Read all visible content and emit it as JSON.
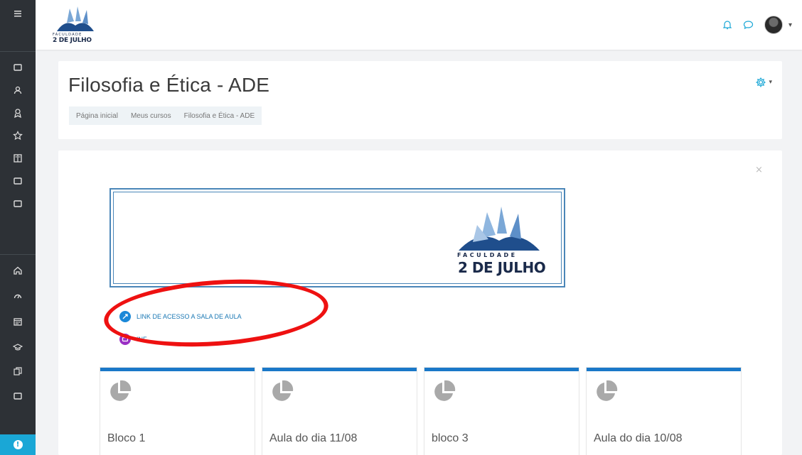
{
  "sidebar": {
    "items": [
      {
        "icon": "menu-icon",
        "label": "Menu"
      },
      {
        "icon": "folder-icon",
        "label": "Folder"
      },
      {
        "icon": "users-icon",
        "label": "Participants"
      },
      {
        "icon": "badge-icon",
        "label": "Badges"
      },
      {
        "icon": "star-icon",
        "label": "Competencies"
      },
      {
        "icon": "book-icon",
        "label": "Grades"
      },
      {
        "icon": "folder-icon",
        "label": "Folder"
      },
      {
        "icon": "folder-icon",
        "label": "Folder"
      },
      {
        "icon": "home-icon",
        "label": "Home"
      },
      {
        "icon": "dashboard-icon",
        "label": "Dashboard"
      },
      {
        "icon": "calendar-icon",
        "label": "Calendar"
      },
      {
        "icon": "graduation-cap-icon",
        "label": "Courses"
      },
      {
        "icon": "files-icon",
        "label": "Files"
      },
      {
        "icon": "folder-icon",
        "label": "Folder"
      }
    ],
    "help_icon": "info-icon"
  },
  "navbar": {
    "logo_small_text": "FACULDADE",
    "logo_big_text": "2 DE JULHO",
    "notifications_icon": "bell-icon",
    "messages_icon": "chat-icon",
    "avatar": "user-avatar",
    "caret": "▾"
  },
  "header": {
    "title": "Filosofia e Ética - ADE",
    "breadcrumb": [
      "Página inicial",
      "Meus cursos",
      "Filosofia e Ética - ADE"
    ],
    "gear_icon": "gear-icon",
    "caret": "▾"
  },
  "main": {
    "close_label": "×",
    "banner": {
      "logo_small_text": "FACULDADE",
      "logo_big_text": "2 DE JULHO"
    },
    "activities": [
      {
        "label": "LINK DE ACESSO A SALA DE AULA",
        "icon": "url-icon",
        "color": "#1a88d8"
      },
      {
        "label": "INF",
        "icon": "forum-icon",
        "color": "#9a2fc4"
      }
    ],
    "sections": [
      {
        "title": "Bloco 1",
        "icon": "pie-chart-icon"
      },
      {
        "title": "Aula do dia 11/08",
        "icon": "pie-chart-icon"
      },
      {
        "title": "bloco 3",
        "icon": "pie-chart-icon"
      },
      {
        "title": "Aula do dia 10/08",
        "icon": "pie-chart-icon"
      }
    ]
  },
  "colors": {
    "sidebar": "#2d3136",
    "accent": "#1aa7d6",
    "section_border": "#1a78c8",
    "annotation": "#ee1111"
  }
}
